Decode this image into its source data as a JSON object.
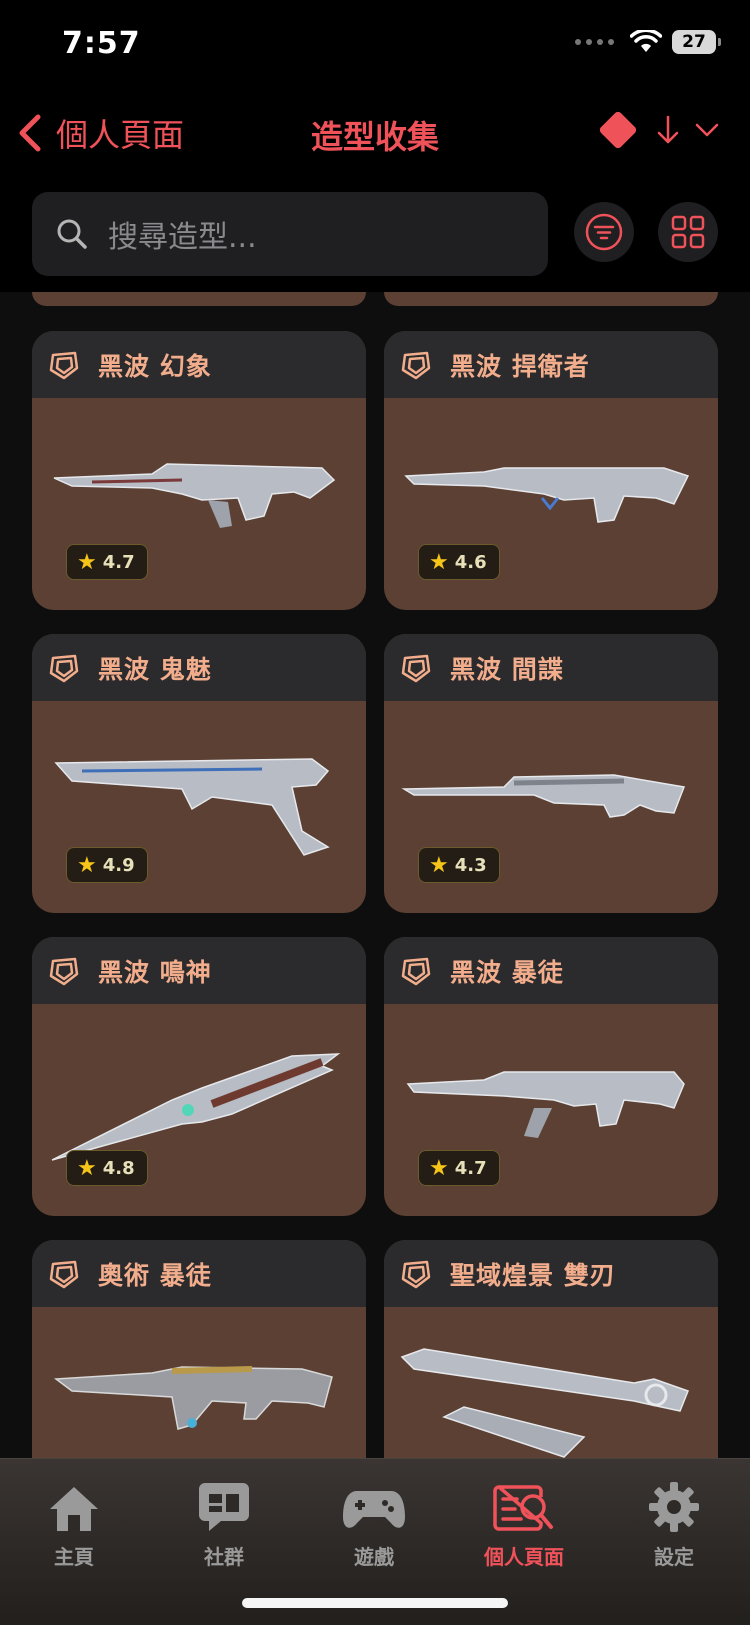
{
  "status": {
    "time": "7:57",
    "battery": "27"
  },
  "header": {
    "back_label": "個人頁面",
    "title": "造型收集"
  },
  "search": {
    "placeholder": "搜尋造型..."
  },
  "colors": {
    "accent": "#f0525a",
    "card_bg": "#5b4033",
    "card_header": "#2b2b2d",
    "name": "#f2ad8c",
    "star": "#f5c518"
  },
  "cards": [
    {
      "name": "黑波 幻象",
      "rating": "4.7",
      "image": "rifle-icon"
    },
    {
      "name": "黑波 捍衛者",
      "rating": "4.6",
      "image": "rifle-icon"
    },
    {
      "name": "黑波 鬼魅",
      "rating": "4.9",
      "image": "pistol-icon"
    },
    {
      "name": "黑波 間諜",
      "rating": "4.3",
      "image": "sniper-icon"
    },
    {
      "name": "黑波 鳴神",
      "rating": "4.8",
      "image": "knife-icon"
    },
    {
      "name": "黑波 暴徒",
      "rating": "4.7",
      "image": "rifle-icon"
    },
    {
      "name": "奧術 暴徒",
      "image": "rifle-icon"
    },
    {
      "name": "聖域煌景 雙刃",
      "image": "blade-icon"
    }
  ],
  "tabs": [
    {
      "label": "主頁",
      "icon": "home-icon"
    },
    {
      "label": "社群",
      "icon": "chat-icon"
    },
    {
      "label": "遊戲",
      "icon": "gamepad-icon"
    },
    {
      "label": "個人頁面",
      "icon": "profile-search-icon",
      "active": true
    },
    {
      "label": "設定",
      "icon": "gear-icon"
    }
  ]
}
